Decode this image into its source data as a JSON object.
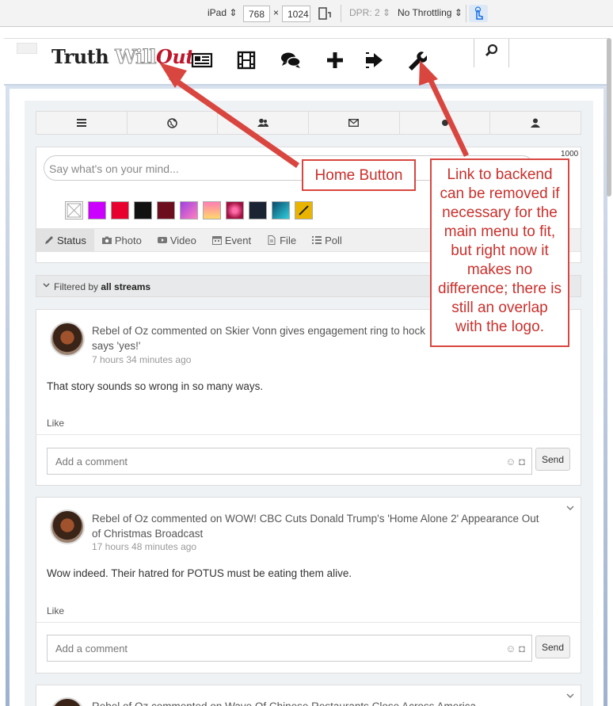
{
  "devtools": {
    "device": "iPad",
    "width": "768",
    "times": "×",
    "height": "1024",
    "dpr": "DPR: 2",
    "throttle": "No Throttling"
  },
  "logo": {
    "w1": "Truth",
    "w2": "Will",
    "w3": "Out"
  },
  "composer": {
    "placeholder": "Say what's on your mind...",
    "char_count": "1000",
    "tabs": [
      "Status",
      "Photo",
      "Video",
      "Event",
      "File",
      "Poll"
    ]
  },
  "filter": {
    "prefix": "Filtered by",
    "value": "all streams"
  },
  "posts": [
    {
      "title": "Rebel of Oz commented on Skier Vonn gives engagement ring to hock",
      "title2": "says 'yes!'",
      "time": "7 hours 34 minutes ago",
      "body": "That story sounds so wrong in so many ways.",
      "like": "Like",
      "comment_placeholder": "Add a comment",
      "send": "Send"
    },
    {
      "title": "Rebel of Oz commented on WOW! CBC Cuts Donald Trump's 'Home Alone 2' Appearance Out of Christmas Broadcast",
      "time": "17 hours 48 minutes ago",
      "body": "Wow indeed. Their hatred for POTUS must be eating them alive.",
      "like": "Like",
      "comment_placeholder": "Add a comment",
      "send": "Send"
    },
    {
      "title": "Rebel of Oz commented on Wave Of Chinese Restaurants Close Across America"
    }
  ],
  "annotations": {
    "home": "Home Button",
    "backend": "Link to backend can be removed if necessary for the main menu to fit, but right now it makes no difference; there is still an overlap with the logo."
  },
  "colors": {
    "annotation": "#d9463f",
    "swatches": [
      "#ffffff",
      "#cc00ff",
      "#e8002e",
      "#111111",
      "#6d0e1f",
      "#c04cd8",
      "#ffb84d",
      "#c02060",
      "#1a2433",
      "#1aa6c8",
      "#e8b400"
    ]
  }
}
